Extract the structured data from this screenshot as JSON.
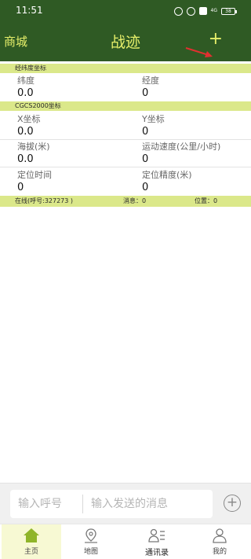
{
  "status_bar": {
    "time": "11:51",
    "network": "4G",
    "battery": "38"
  },
  "header": {
    "left_label": "商城",
    "title": "战迹",
    "add_label": "+"
  },
  "sections": {
    "latlon": {
      "title": "经纬度坐标",
      "latitude": {
        "label": "纬度",
        "value": "0.0"
      },
      "longitude": {
        "label": "经度",
        "value": "0"
      }
    },
    "cgcs": {
      "title": "CGCS2000坐标",
      "x": {
        "label": "X坐标",
        "value": "0.0"
      },
      "y": {
        "label": "Y坐标",
        "value": "0"
      },
      "altitude": {
        "label": "海拔(米)",
        "value": "0.0"
      },
      "speed": {
        "label": "运动速度(公里/小时)",
        "value": "0"
      },
      "fix_time": {
        "label": "定位时间",
        "value": "0"
      },
      "accuracy": {
        "label": "定位精度(米)",
        "value": "0"
      }
    }
  },
  "online_bar": {
    "status": "在线(呼号:327273 )",
    "messages": "消息：0",
    "position": "位置：0"
  },
  "compose": {
    "callsign_placeholder": "输入呼号",
    "message_placeholder": "输入发送的消息",
    "add_label": "+"
  },
  "tabs": [
    {
      "label": "主页",
      "icon": "home-icon",
      "active": true
    },
    {
      "label": "地图",
      "icon": "map-pin-icon",
      "active": false
    },
    {
      "label": "通讯录",
      "icon": "contacts-icon",
      "active": false
    },
    {
      "label": "我的",
      "icon": "person-icon",
      "active": false
    }
  ],
  "colors": {
    "header": "#2f5a24",
    "accent_text": "#e6ef6a",
    "section_bar": "#dbe88a",
    "active_tab_icon": "#8fb52a",
    "annotation_arrow": "#e03030"
  }
}
